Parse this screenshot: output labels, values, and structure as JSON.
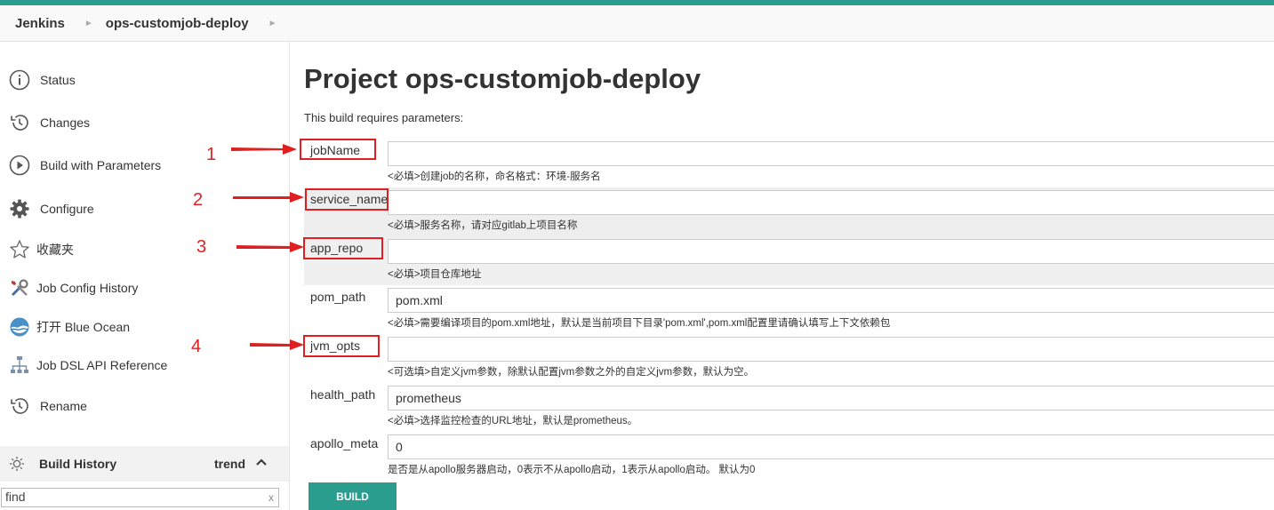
{
  "breadcrumb": {
    "root": "Jenkins",
    "job": "ops-customjob-deploy"
  },
  "sidebar": {
    "items": [
      {
        "label": "Status",
        "icon": "info-icon"
      },
      {
        "label": "Changes",
        "icon": "history-icon"
      },
      {
        "label": "Build with Parameters",
        "icon": "play-icon"
      },
      {
        "label": "Configure",
        "icon": "gear-icon"
      },
      {
        "label": "收藏夹",
        "icon": "star-icon"
      },
      {
        "label": "Job Config History",
        "icon": "tools-icon"
      },
      {
        "label": "打开 Blue Ocean",
        "icon": "blue-ocean-icon"
      },
      {
        "label": "Job DSL API Reference",
        "icon": "sitemap-icon"
      },
      {
        "label": "Rename",
        "icon": "history-icon"
      }
    ],
    "build_history": {
      "label": "Build History",
      "trend": "trend"
    },
    "find": {
      "value": "find",
      "clear": "x"
    }
  },
  "main": {
    "title": "Project ops-customjob-deploy",
    "requires": "This build requires parameters:",
    "params": [
      {
        "name": "jobName",
        "value": "",
        "desc": "<必填>创建job的名称，命名格式：环境-服务名"
      },
      {
        "name": "service_name",
        "value": "",
        "desc": "<必填>服务名称，请对应gitlab上项目名称"
      },
      {
        "name": "app_repo",
        "value": "",
        "desc": "<必填>项目仓库地址"
      },
      {
        "name": "pom_path",
        "value": "pom.xml",
        "desc": "<必填>需要编译项目的pom.xml地址，默认是当前项目下目录'pom.xml',pom.xml配置里请确认填写上下文依赖包"
      },
      {
        "name": "jvm_opts",
        "value": "",
        "desc": "<可选填>自定义jvm参数，除默认配置jvm参数之外的自定义jvm参数，默认为空。"
      },
      {
        "name": "health_path",
        "value": "prometheus",
        "desc": "<必填>选择监控检查的URL地址，默认是prometheus。"
      },
      {
        "name": "apollo_meta",
        "value": "0",
        "desc": "是否是从apollo服务器启动，0表示不从apollo启动，1表示从apollo启动。 默认为0"
      }
    ],
    "build_label": "BUILD"
  },
  "annotations": [
    "1",
    "2",
    "3",
    "4"
  ],
  "colors": {
    "accent": "#2a9d8f",
    "annotation": "#e02020"
  }
}
